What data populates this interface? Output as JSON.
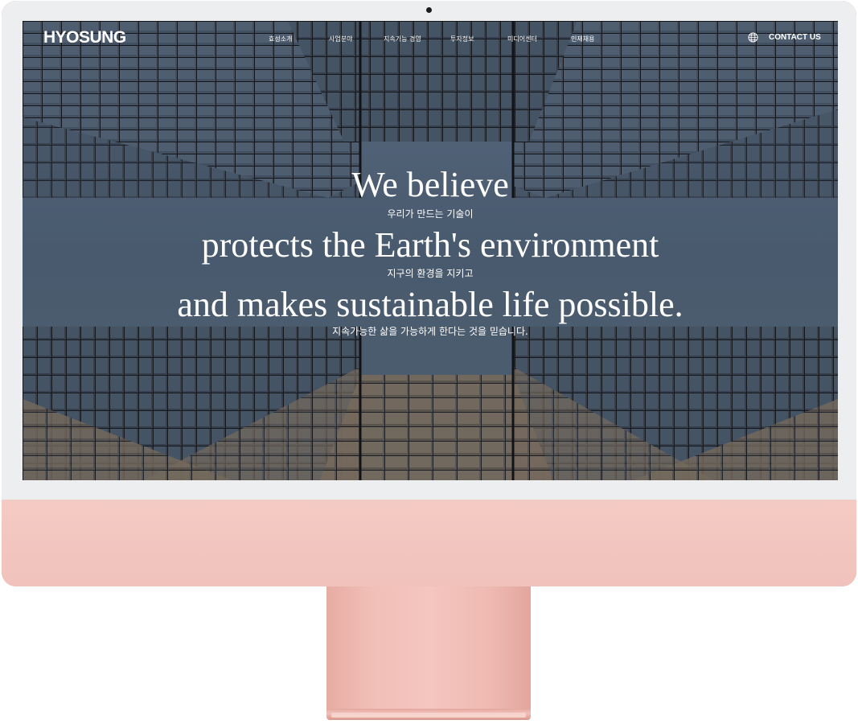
{
  "header": {
    "logo": "HYOSUNG",
    "nav": [
      {
        "label": "효성소개"
      },
      {
        "label": "사업분야"
      },
      {
        "label": "지속가능 경영"
      },
      {
        "label": "투자정보"
      },
      {
        "label": "미디어센터"
      },
      {
        "label": "인재채용"
      }
    ],
    "language_icon": "globe-icon",
    "contact_label": "CONTACT US"
  },
  "hero": {
    "line1_en": "We believe",
    "line1_ko": "우리가 만드는 기술이",
    "line2_en": "protects the Earth's environment",
    "line2_ko": "지구의 환경을 지키고",
    "line3_en": "and makes sustainable life possible.",
    "line3_ko": "지속가능한 삶을 가능하게 한다는 것을 믿습니다."
  },
  "colors": {
    "sky": "#56697d",
    "building_dark": "#1f2124",
    "glass": "#3d4c5c",
    "device_pink": "#f2c7c1",
    "bezel": "#eceef0"
  }
}
